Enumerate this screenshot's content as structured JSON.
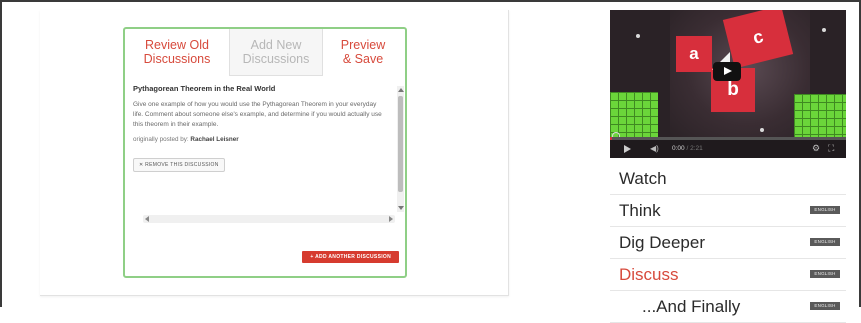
{
  "editor": {
    "tabs": [
      {
        "label_line1": "Review Old",
        "label_line2": "Discussions",
        "state": "available"
      },
      {
        "label_line1": "Add New",
        "label_line2": "Discussions",
        "state": "current"
      },
      {
        "label_line1": "Preview",
        "label_line2": "& Save",
        "state": "available"
      }
    ],
    "discussion": {
      "title": "Pythagorean Theorem in the Real World",
      "body": "Give one example of how you would use the Pythagorean Theorem in your everyday life. Comment about someone else's example, and determine if you would actually use this theorem in their example.",
      "posted_by_label": "originally posted by:",
      "posted_by_name": "Rachael Leisner",
      "remove_label": "✕ REMOVE THIS DISCUSSION"
    },
    "add_button_label": "+ ADD ANOTHER DISCUSSION"
  },
  "video": {
    "shape_labels": {
      "a": "a",
      "b": "b",
      "c": "c"
    },
    "time_current": "0:00",
    "time_total": "2:21",
    "progress": 0.01
  },
  "nav": {
    "items": [
      {
        "label": "Watch",
        "badge": ""
      },
      {
        "label": "Think",
        "badge": "ENGLISH"
      },
      {
        "label": "Dig Deeper",
        "badge": "ENGLISH"
      },
      {
        "label": "Discuss",
        "badge": "ENGLISH"
      },
      {
        "label": "...And Finally",
        "badge": "ENGLISH"
      }
    ]
  },
  "colors": {
    "accent_red": "#d74a3c",
    "border_green": "#8fcf86",
    "shape_red": "#d72f3c",
    "grid_green": "#6bd63a"
  }
}
